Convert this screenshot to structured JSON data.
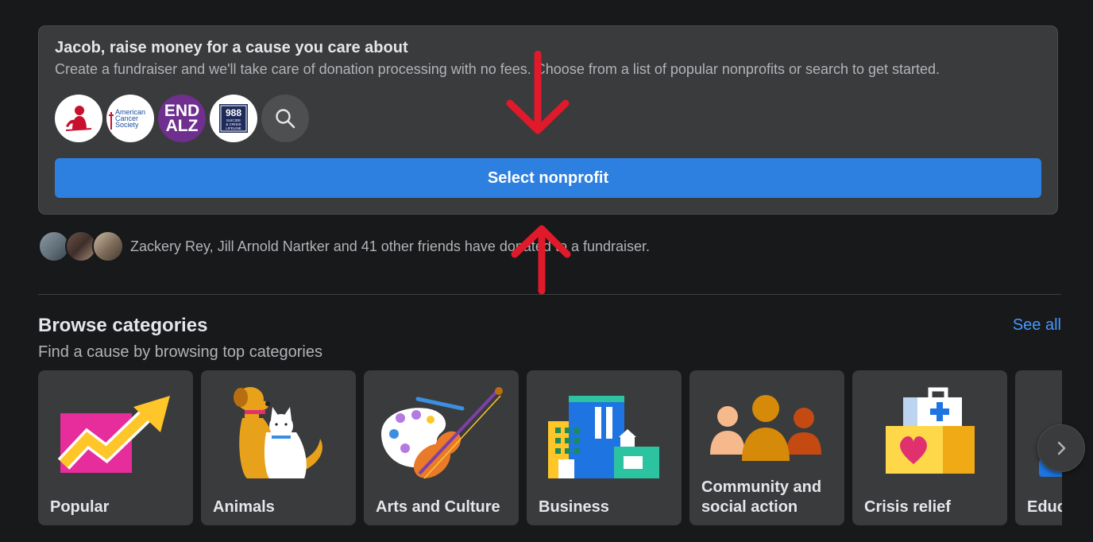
{
  "fundraiser_card": {
    "title": "Jacob, raise money for a cause you care about",
    "subtitle": "Create a fundraiser and we'll take care of donation processing with no fees. Choose from a list of popular nonprofits or search to get started.",
    "nonprofits": [
      {
        "name": "st-jude-logo"
      },
      {
        "name": "american-cancer-society-logo",
        "lines": [
          "American",
          "Cancer",
          "Society"
        ]
      },
      {
        "name": "end-alz-logo",
        "lines": [
          "END",
          "ALZ"
        ]
      },
      {
        "name": "988-lifeline-logo",
        "number": "988",
        "lines": [
          "SUICIDE",
          "& CRISIS",
          "LIFELINE"
        ]
      }
    ],
    "search_icon": "search-icon",
    "select_button": "Select nonprofit",
    "button_color": "#2d7fe0"
  },
  "friends": {
    "text": "Zackery Rey, Jill Arnold Nartker and 41 other friends have donated to a fundraiser."
  },
  "browse": {
    "title": "Browse categories",
    "subtitle": "Find a cause by browsing top categories",
    "see_all": "See all",
    "categories": [
      {
        "label": "Popular",
        "icon": "trending-chart-icon"
      },
      {
        "label": "Animals",
        "icon": "dog-and-cat-icon"
      },
      {
        "label": "Arts and Culture",
        "icon": "palette-and-violin-icon"
      },
      {
        "label": "Business",
        "icon": "buildings-icon"
      },
      {
        "label": "Community and",
        "label2": "social action",
        "icon": "people-group-icon"
      },
      {
        "label": "Crisis relief",
        "icon": "first-aid-kit-icon"
      },
      {
        "label": "Educ",
        "icon": "education-icon"
      }
    ],
    "next_icon": "chevron-right-icon"
  },
  "annotation_color": "#e0192b"
}
